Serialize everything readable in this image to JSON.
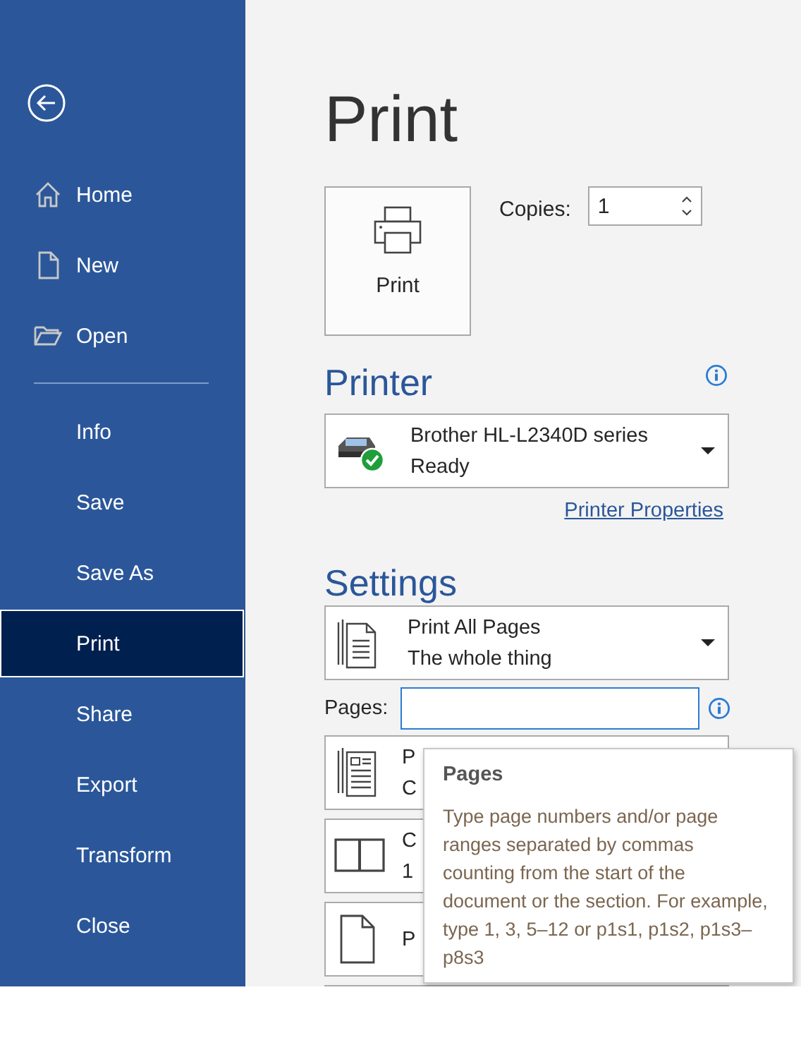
{
  "sidebar": {
    "items": [
      {
        "label": "Home",
        "selected": false,
        "kind": "icon"
      },
      {
        "label": "New",
        "selected": false,
        "kind": "icon"
      },
      {
        "label": "Open",
        "selected": false,
        "kind": "icon"
      },
      {
        "label": "Info",
        "selected": false,
        "kind": "text"
      },
      {
        "label": "Save",
        "selected": false,
        "kind": "text"
      },
      {
        "label": "Save As",
        "selected": false,
        "kind": "text"
      },
      {
        "label": "Print",
        "selected": true,
        "kind": "text"
      },
      {
        "label": "Share",
        "selected": false,
        "kind": "text"
      },
      {
        "label": "Export",
        "selected": false,
        "kind": "text"
      },
      {
        "label": "Transform",
        "selected": false,
        "kind": "text"
      },
      {
        "label": "Close",
        "selected": false,
        "kind": "text"
      }
    ]
  },
  "page_title": "Print",
  "print_button": {
    "label": "Print"
  },
  "copies": {
    "label": "Copies:",
    "value": "1"
  },
  "printer": {
    "heading": "Printer",
    "name": "Brother HL-L2340D series",
    "status": "Ready",
    "ready": true,
    "properties_link": "Printer Properties"
  },
  "settings": {
    "heading": "Settings",
    "range": {
      "title": "Print All Pages",
      "subtitle": "The whole thing"
    },
    "pages": {
      "label": "Pages:"
    },
    "options": [
      {
        "line_1": "P",
        "line_2": "C"
      },
      {
        "line_1": "C",
        "line_2": "1"
      },
      {
        "line_1": "P"
      }
    ]
  },
  "tooltip": {
    "title": "Pages",
    "text": "Type page numbers and/or page ranges separated by commas counting from the start of the document or the section. For example, type 1, 3, 5–12 or p1s1, p1s2, p1s3–p8s3"
  }
}
